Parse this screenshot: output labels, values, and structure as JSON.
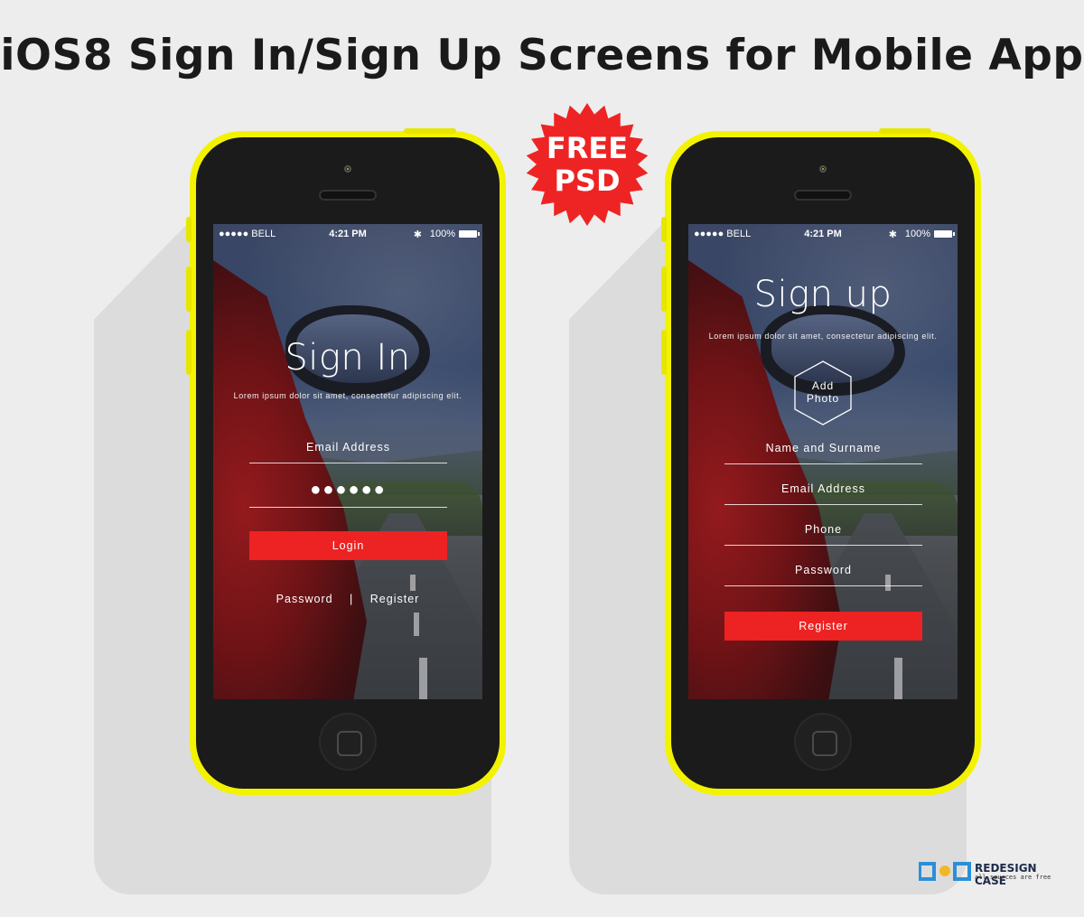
{
  "page": {
    "title": "iOS8 Sign In/Sign Up Screens for Mobile App"
  },
  "badge": {
    "line1": "FREE",
    "line2": "PSD",
    "color": "#ee2424"
  },
  "colors": {
    "phone_body": "#f3f300",
    "accent_button": "#ed2222"
  },
  "status_bar": {
    "carrier": "●●●●● BELL",
    "time": "4:21 PM",
    "battery": "100%"
  },
  "signin": {
    "title": "Sign In",
    "subtitle": "Lorem ipsum dolor sit amet, consectetur adipiscing elit.",
    "email_label": "Email Address",
    "password_value": "●●●●●●",
    "login_label": "Login",
    "password_link": "Password",
    "separator": "|",
    "register_link": "Register"
  },
  "signup": {
    "title": "Sign up",
    "subtitle": "Lorem ipsum dolor sit amet, consectetur adipiscing elit.",
    "photo_line1": "Add",
    "photo_line2": "Photo",
    "name_label": "Name and Surname",
    "email_label": "Email Address",
    "phone_label": "Phone",
    "password_label": "Password",
    "register_label": "Register"
  },
  "logo": {
    "name": "REDESIGN CASE",
    "tagline": "all sources are free"
  }
}
